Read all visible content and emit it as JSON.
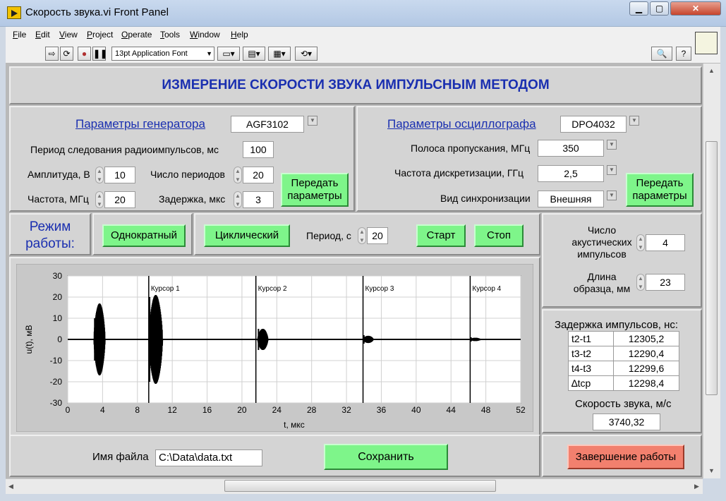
{
  "window": {
    "title": "Скорость звука.vi Front Panel"
  },
  "menu": [
    "File",
    "Edit",
    "View",
    "Project",
    "Operate",
    "Tools",
    "Window",
    "Help"
  ],
  "toolbar": {
    "font": "13pt Application Font"
  },
  "main_title": "ИЗМЕРЕНИЕ СКОРОСТИ ЗВУКА ИМПУЛЬСНЫМ МЕТОДОМ",
  "generator": {
    "title": "Параметры генератора",
    "model": "AGF3102",
    "period_label": "Период следования радиоимпульсов, мс",
    "period_value": "100",
    "amplitude_label": "Амплитуда, В",
    "amplitude_value": "10",
    "num_periods_label": "Число периодов",
    "num_periods_value": "20",
    "frequency_label": "Частота, МГц",
    "frequency_value": "20",
    "delay_label": "Задержка, мкс",
    "delay_value": "3",
    "send_button_line1": "Передать",
    "send_button_line2": "параметры"
  },
  "oscilloscope": {
    "title": "Параметры осциллографа",
    "model": "DPO4032",
    "bandwidth_label": "Полоса пропускания, МГц",
    "bandwidth_value": "350",
    "sampling_label": "Частота дискретизации, ГГц",
    "sampling_value": "2,5",
    "sync_label": "Вид синхронизации",
    "sync_value": "Внешняя",
    "send_button_line1": "Передать",
    "send_button_line2": "параметры"
  },
  "mode": {
    "label_line1": "Режим",
    "label_line2": "работы:",
    "single_button": "Однократный",
    "cyclic_button": "Циклический",
    "period_label": "Период, с",
    "period_value": "20",
    "start_button": "Старт",
    "stop_button": "Стоп"
  },
  "acoustic": {
    "pulses_label_line1": "Число",
    "pulses_label_line2": "акустических",
    "pulses_label_line3": "импульсов",
    "pulses_value": "4",
    "length_label_line1": "Длина",
    "length_label_line2": "образца, мм",
    "length_value": "23"
  },
  "delays": {
    "title": "Задержка импульсов, нс:",
    "rows": [
      {
        "name": "t2-t1",
        "value": "12305,2"
      },
      {
        "name": "t3-t2",
        "value": "12290,4"
      },
      {
        "name": "t4-t3",
        "value": "12299,6"
      },
      {
        "name": "∆tср",
        "value": "12298,4"
      }
    ],
    "speed_label": "Скорость звука, м/с",
    "speed_value": "3740,32"
  },
  "file": {
    "label": "Имя файла",
    "path": "C:\\Data\\data.txt",
    "save_button": "Сохранить"
  },
  "finish_button": "Завершение работы",
  "chart_data": {
    "type": "line",
    "title": "",
    "xlabel": "t, мкс",
    "ylabel": "u(t), мВ",
    "xlim": [
      0,
      52
    ],
    "ylim": [
      -30,
      30
    ],
    "x_ticks": [
      0,
      4,
      8,
      12,
      16,
      20,
      24,
      28,
      32,
      36,
      40,
      44,
      48,
      52
    ],
    "y_ticks": [
      30,
      20,
      10,
      0,
      -10,
      -20,
      -30
    ],
    "grid": true,
    "cursors": [
      {
        "label": "Курсор 1",
        "x": 9.3
      },
      {
        "label": "Курсор 2",
        "x": 21.6
      },
      {
        "label": "Курсор 3",
        "x": 33.9
      },
      {
        "label": "Курсор 4",
        "x": 46.2
      }
    ],
    "pulses": [
      {
        "start": 3.0,
        "end": 4.3,
        "amplitude": 17,
        "peak": 10
      },
      {
        "start": 9.3,
        "end": 10.9,
        "amplitude": 21,
        "peak": 20
      },
      {
        "start": 21.8,
        "end": 23.0,
        "amplitude": 5,
        "peak": 5
      },
      {
        "start": 33.9,
        "end": 35.1,
        "amplitude": 1.7,
        "peak": 2
      },
      {
        "start": 46.2,
        "end": 47.4,
        "amplitude": 0.8,
        "peak": 1
      }
    ]
  }
}
